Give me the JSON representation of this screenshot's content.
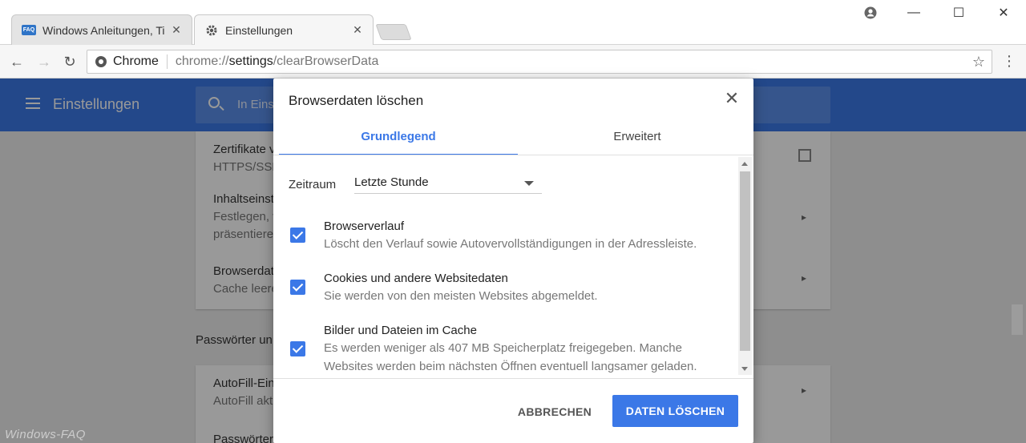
{
  "tabs": [
    {
      "title": "Windows Anleitungen, Ti",
      "favicon": "FAQ",
      "active": false
    },
    {
      "title": "Einstellungen",
      "favicon": "gear-icon",
      "active": true
    }
  ],
  "toolbar": {
    "site_chip": "Chrome",
    "url_prefix": "chrome://",
    "url_host": "settings",
    "url_path": "/clearBrowserData"
  },
  "settings": {
    "title": "Einstellungen",
    "search_placeholder": "In Eins",
    "rows": [
      {
        "title": "Zertifikate v",
        "sub": "HTTPS/SSL"
      },
      {
        "title": "Inhaltseinst",
        "sub": "Festlegen, v",
        "sub2": "präsentiere"
      },
      {
        "title": "Browserdat",
        "sub": "Cache leere"
      }
    ],
    "section_title": "Passwörter un",
    "rows2": [
      {
        "title": "AutoFill-Ein",
        "sub": "AutoFill akt"
      },
      {
        "title": "Passwörter"
      }
    ],
    "watermark": "Windows-FAQ"
  },
  "dialog": {
    "title": "Browserdaten löschen",
    "tab_basic": "Grundlegend",
    "tab_advanced": "Erweitert",
    "range_label": "Zeitraum",
    "range_value": "Letzte Stunde",
    "options": [
      {
        "title": "Browserverlauf",
        "desc": "Löscht den Verlauf sowie Autovervollständigungen in der Adressleiste.",
        "checked": true
      },
      {
        "title": "Cookies und andere Websitedaten",
        "desc": "Sie werden von den meisten Websites abgemeldet.",
        "checked": true
      },
      {
        "title": "Bilder und Dateien im Cache",
        "desc": "Es werden weniger als 407 MB Speicherplatz freigegeben. Manche Websites werden beim nächsten Öffnen eventuell langsamer geladen.",
        "checked": true
      }
    ],
    "cancel_label": "ABBRECHEN",
    "confirm_label": "DATEN LÖSCHEN"
  },
  "colors": {
    "accent": "#3b78e7",
    "header": "#3b78e7"
  }
}
